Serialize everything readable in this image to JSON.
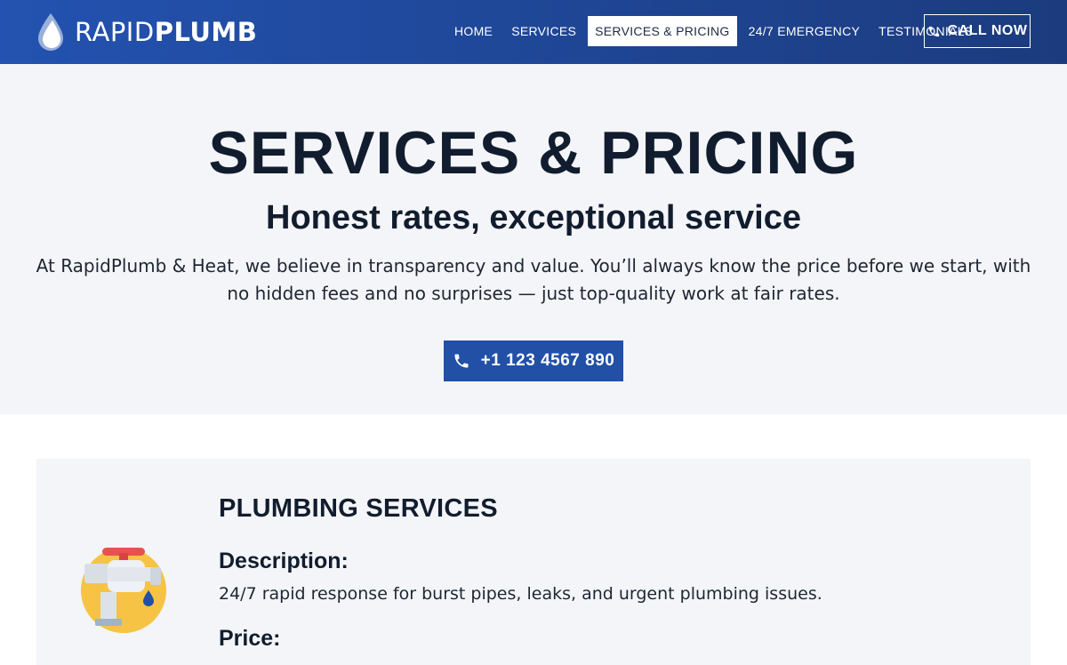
{
  "brand": {
    "name_light": "RAPID",
    "name_bold": "PLUMB"
  },
  "nav": {
    "items": [
      {
        "label": "HOME"
      },
      {
        "label": "SERVICES"
      },
      {
        "label": "SERVICES & PRICING",
        "active": true
      },
      {
        "label": "24/7 EMERGENCY"
      },
      {
        "label": "TESTIMONIALS"
      }
    ],
    "call_now": "CALL NOW"
  },
  "hero": {
    "title": "SERVICES & PRICING",
    "subtitle": "Honest rates, exceptional service",
    "body": "At RapidPlumb & Heat, we believe in transparency and value. You’ll always know the price before we start, with no hidden fees and no surprises — just top-quality work at fair rates.",
    "phone": "+1 123 4567 890"
  },
  "services": [
    {
      "title": "PLUMBING SERVICES",
      "icon": "faucet-icon",
      "description_label": "Description:",
      "description": "24/7 rapid response for burst pipes, leaks, and urgent plumbing issues.",
      "price_label": "Price:",
      "price": ""
    }
  ],
  "colors": {
    "header_start": "#2352b0",
    "header_end": "#1c3b7e",
    "accent": "#2150a6",
    "hero_bg": "#f4f5f8",
    "text_dark": "#111d2e"
  }
}
